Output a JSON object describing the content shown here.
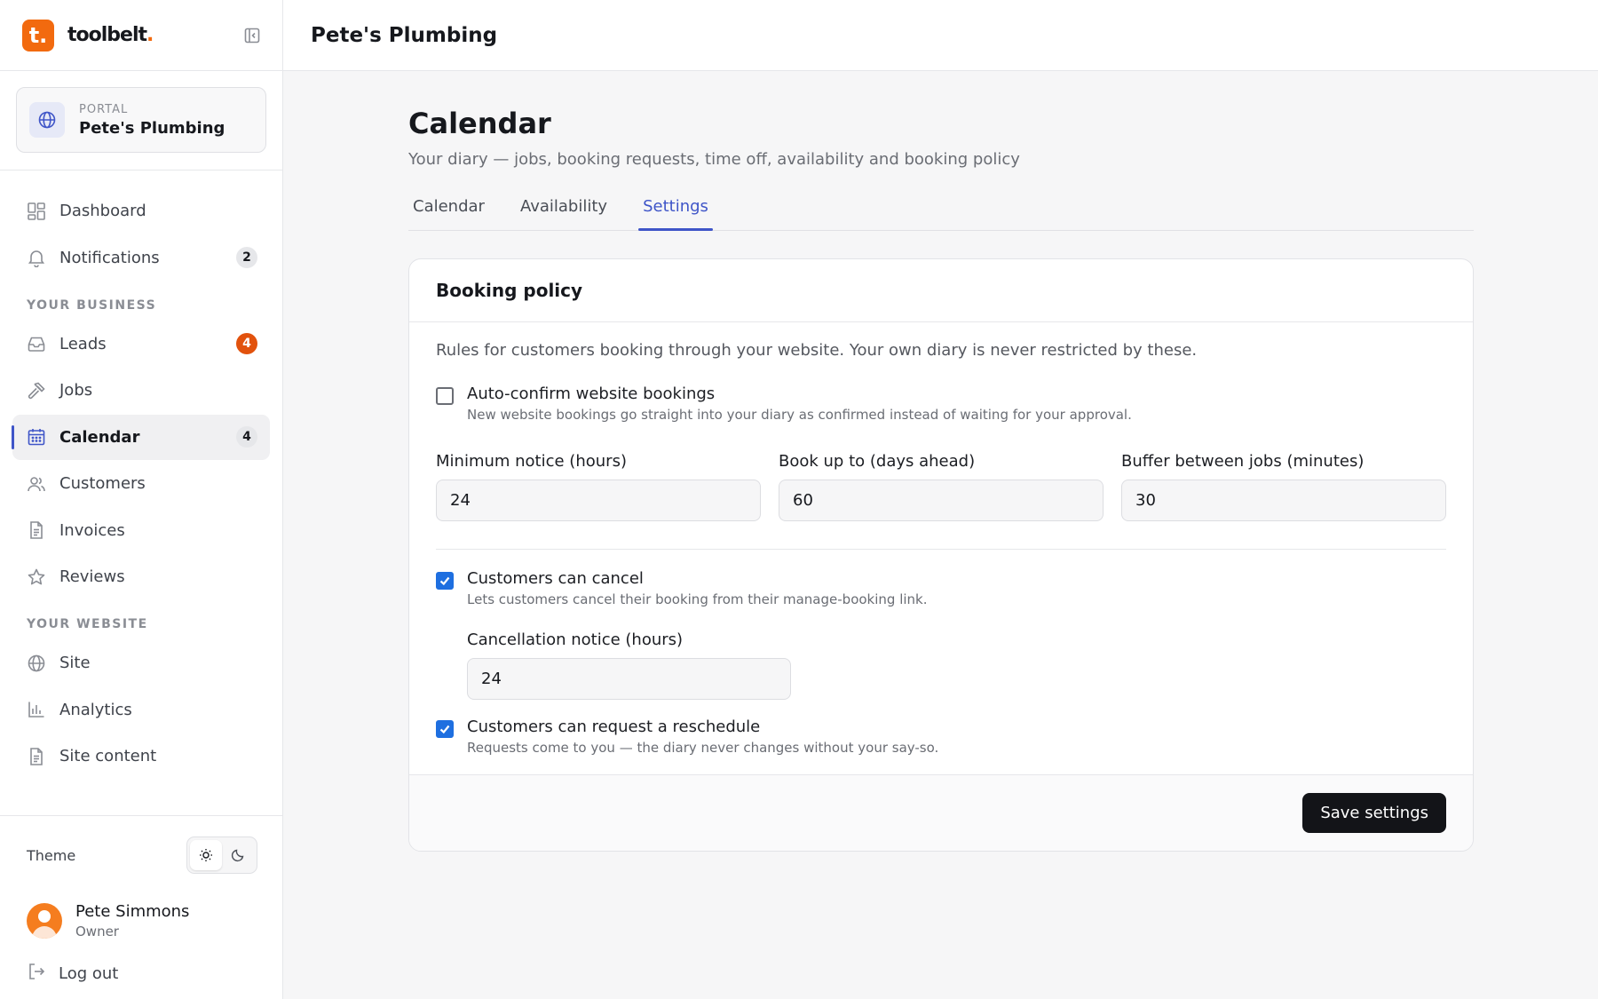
{
  "brand": {
    "logo_letter": "t.",
    "name": "toolbelt",
    "name_dot": "."
  },
  "portal": {
    "label": "PORTAL",
    "name": "Pete's Plumbing"
  },
  "nav": {
    "dashboard": "Dashboard",
    "notifications": {
      "label": "Notifications",
      "badge": "2"
    },
    "section_business": "YOUR BUSINESS",
    "leads": {
      "label": "Leads",
      "badge": "4"
    },
    "jobs": "Jobs",
    "calendar": {
      "label": "Calendar",
      "badge": "4"
    },
    "customers": "Customers",
    "invoices": "Invoices",
    "reviews": "Reviews",
    "section_website": "YOUR WEBSITE",
    "site": "Site",
    "analytics": "Analytics",
    "site_content": "Site content"
  },
  "theme": {
    "label": "Theme"
  },
  "user": {
    "name": "Pete Simmons",
    "role": "Owner",
    "logout": "Log out"
  },
  "header": {
    "title": "Pete's Plumbing"
  },
  "page": {
    "title": "Calendar",
    "subtitle": "Your diary — jobs, booking requests, time off, availability and booking policy",
    "tabs": [
      "Calendar",
      "Availability",
      "Settings"
    ]
  },
  "booking": {
    "title": "Booking policy",
    "description": "Rules for customers booking through your website. Your own diary is never restricted by these.",
    "auto_confirm": {
      "label": "Auto-confirm website bookings",
      "help": "New website bookings go straight into your diary as confirmed instead of waiting for your approval.",
      "checked": false
    },
    "min_notice": {
      "label": "Minimum notice (hours)",
      "value": "24"
    },
    "book_up_to": {
      "label": "Book up to (days ahead)",
      "value": "60"
    },
    "buffer": {
      "label": "Buffer between jobs (minutes)",
      "value": "30"
    },
    "can_cancel": {
      "label": "Customers can cancel",
      "help": "Lets customers cancel their booking from their manage-booking link.",
      "checked": true
    },
    "cancel_notice": {
      "label": "Cancellation notice (hours)",
      "value": "24"
    },
    "can_reschedule": {
      "label": "Customers can request a reschedule",
      "help": "Requests come to you — the diary never changes without your say-so.",
      "checked": true
    },
    "save_label": "Save settings"
  },
  "colors": {
    "brand": "#f26a0f",
    "accent": "#3f55c8",
    "checkbox": "#1e6fe0",
    "badge_orange": "#e2520d"
  }
}
